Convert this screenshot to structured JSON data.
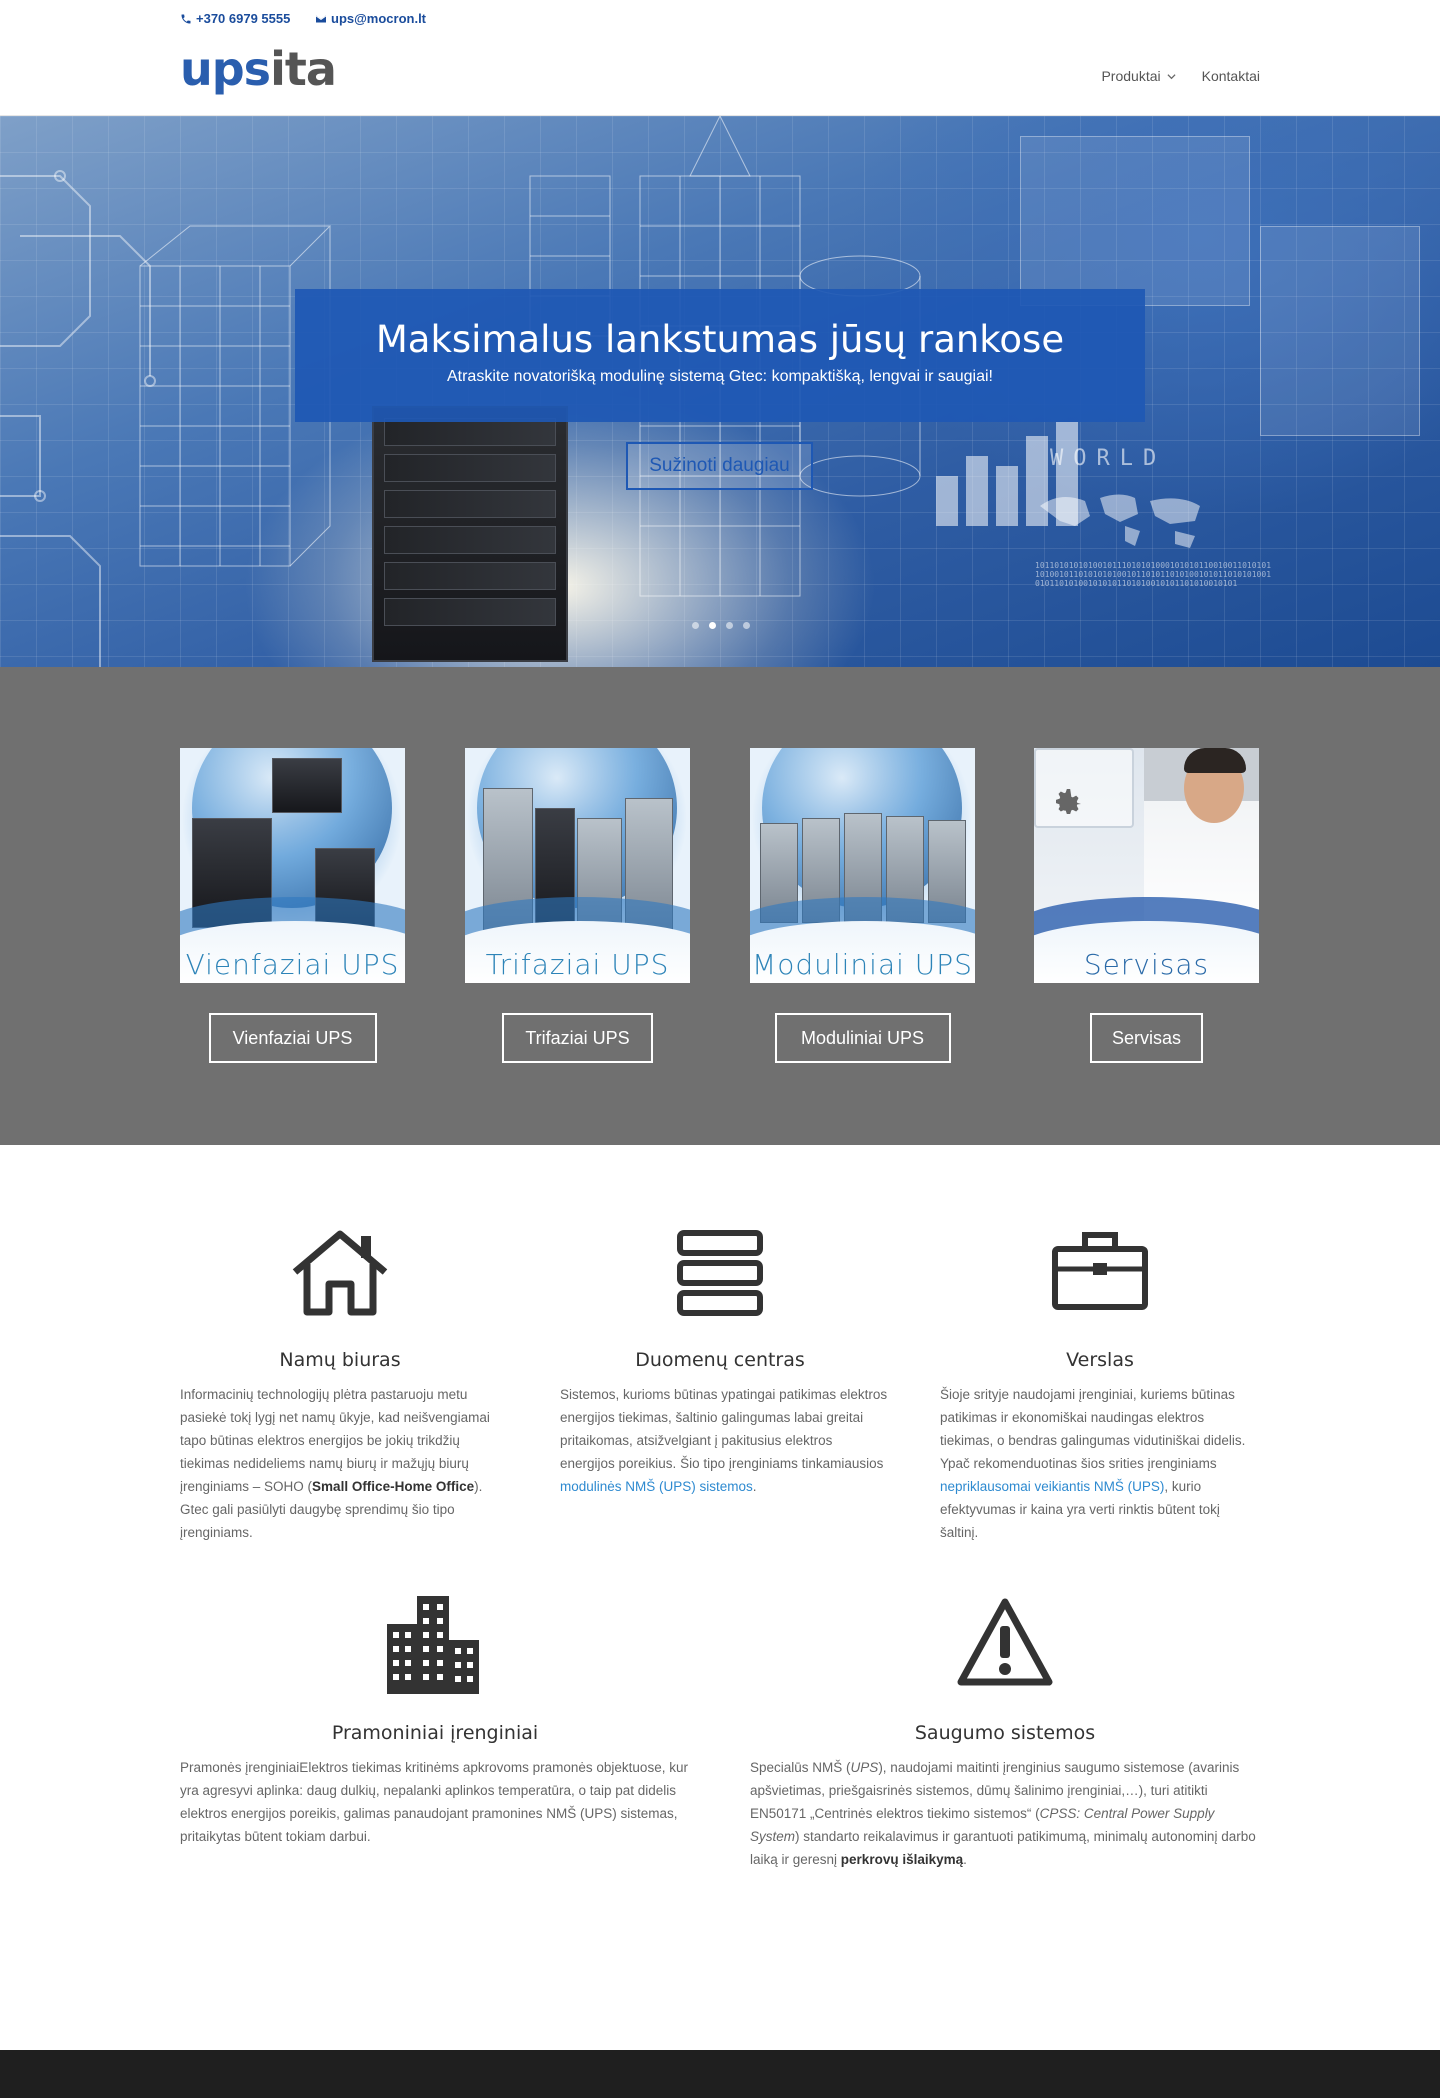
{
  "topbar": {
    "phone": "+370 6979 5555",
    "email": "ups@mocron.lt",
    "phone_icon": "phone-icon",
    "email_icon": "envelope-icon"
  },
  "header": {
    "logo_part1": "ups",
    "logo_part2": "ita",
    "nav": [
      {
        "label": "Produktai",
        "has_dropdown": true
      },
      {
        "label": "Kontaktai",
        "has_dropdown": false
      }
    ]
  },
  "hero": {
    "title": "Maksimalus lankstumas jūsų rankose",
    "subtitle": "Atraskite novatorišką modulinę sistemą Gtec: kompaktišką, lengvai ir saugiai!",
    "button": "Sužinoti daugiau",
    "decor_text": "WORLD",
    "binary_text": "10110101010100101110101010001010101100100110101011010010110101010100101101011010100101011010101001010110101001010101101010010101101010010101",
    "slides": 4,
    "active_slide": 2
  },
  "products": [
    {
      "caption": "Vienfaziai UPS",
      "button": "Vienfaziai UPS"
    },
    {
      "caption": "Trifaziai UPS",
      "button": "Trifaziai UPS"
    },
    {
      "caption": "Moduliniai UPS",
      "button": "Moduliniai UPS"
    },
    {
      "caption": "Servisas",
      "button": "Servisas"
    }
  ],
  "features": [
    {
      "icon": "house-icon",
      "title": "Namų biuras",
      "text_1": "Informacinių technologijų plėtra pastaruoju metu pasiekė tokį lygį net namų ūkyje, kad neišvengiamai tapo būtinas elektros energijos be jokių trikdžių tiekimas nedideliems namų biurų ir mažųjų biurų įrenginiams – SOHO (",
      "text_bold": "Small Office-Home Office",
      "text_2": "). Gtec gali pasiūlyti daugybę sprendimų šio tipo įrenginiams."
    },
    {
      "icon": "server-stack-icon",
      "title": "Duomenų centras",
      "text_1": "Sistemos, kurioms būtinas ypatingai patikimas elektros energijos tiekimas, šaltinio galingumas labai greitai pritaikomas, atsižvelgiant į pakitusius elektros energijos poreikius. Šio tipo įrenginiams tinkamiausios ",
      "link": "modulinės NMŠ (UPS) sistemos",
      "text_2": "."
    },
    {
      "icon": "briefcase-icon",
      "title": "Verslas",
      "text_1": "Šioje srityje naudojami įrenginiai, kuriems būtinas patikimas ir ekonomiškai naudingas elektros tiekimas, o bendras galingumas vidutiniškai didelis. Ypač rekomenduotinas šios srities įrenginiams ",
      "link": "nepriklausomai veikiantis NMŠ (UPS)",
      "text_2": ", kurio efektyvumas ir kaina yra verti rinktis būtent tokį šaltinį."
    },
    {
      "icon": "buildings-icon",
      "title": "Pramoniniai įrenginiai",
      "text_1": "Pramonės įrenginiaiElektros tiekimas kritinėms apkrovoms pramonės objektuose, kur yra agresyvi aplinka: daug dulkių, nepalanki aplinkos temperatūra, o taip pat didelis elektros energijos poreikis, galimas panaudojant pramonines NMŠ (UPS) sistemas, pritaikytas būtent tokiam darbui."
    },
    {
      "icon": "warning-icon",
      "title": "Saugumo sistemos",
      "text_1": "Specialūs NMŠ (",
      "italic_1": "UPS",
      "text_2": "), naudojami maitinti įrenginius saugumo sistemose (avarinis apšvietimas, priešgaisrinės sistemos, dūmų šalinimo įrenginiai,…), turi atitikti EN50171 „Centrinės elektros tiekimo sistemos“ (",
      "italic_2": "CPSS: Central Power Supply System",
      "text_3": ") standarto reikalavimus ir garantuoti patikimumą, minimalų autonominį darbo laiką ir geresnį ",
      "text_bold": "perkrovų išlaikymą",
      "text_4": "."
    }
  ],
  "colors": {
    "brand_blue": "#2a5eae",
    "hero_box": "#1e58b4",
    "section_gray": "#707070",
    "link": "#2e8ad0",
    "footer": "#1f1f1f"
  }
}
